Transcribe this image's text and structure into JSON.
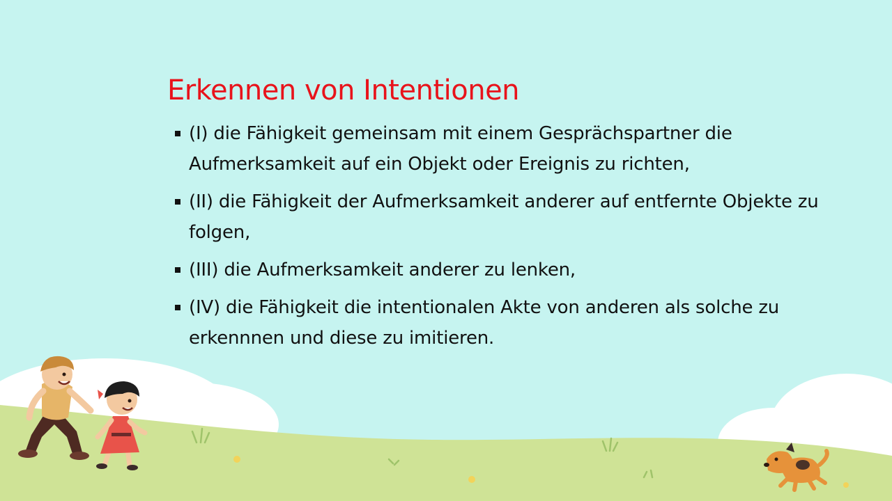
{
  "slide": {
    "title": "Erkennen von Intentionen",
    "bullets": [
      "(I) die Fähigkeit gemeinsam mit einem Gesprächspartner die Aufmerksamkeit auf ein Objekt oder Ereignis zu richten,",
      "(II) die Fähigkeit der Aufmerksamkeit anderer auf entfernte Objekte zu folgen,",
      "(III) die Aufmerksamkeit anderer zu lenken,",
      "(IV) die Fähigkeit die intentionalen Akte von anderen als solche zu erkennnen und diese zu imitieren."
    ]
  },
  "colors": {
    "sky": "#c6f4f0",
    "title": "#e8131b",
    "text": "#111111",
    "grass": "#cfe396",
    "cloud": "#ffffff"
  },
  "illustration": {
    "background": "sky-with-clouds-and-grass-hill",
    "figures": [
      "boy-running",
      "girl-running",
      "orange-dog"
    ]
  }
}
